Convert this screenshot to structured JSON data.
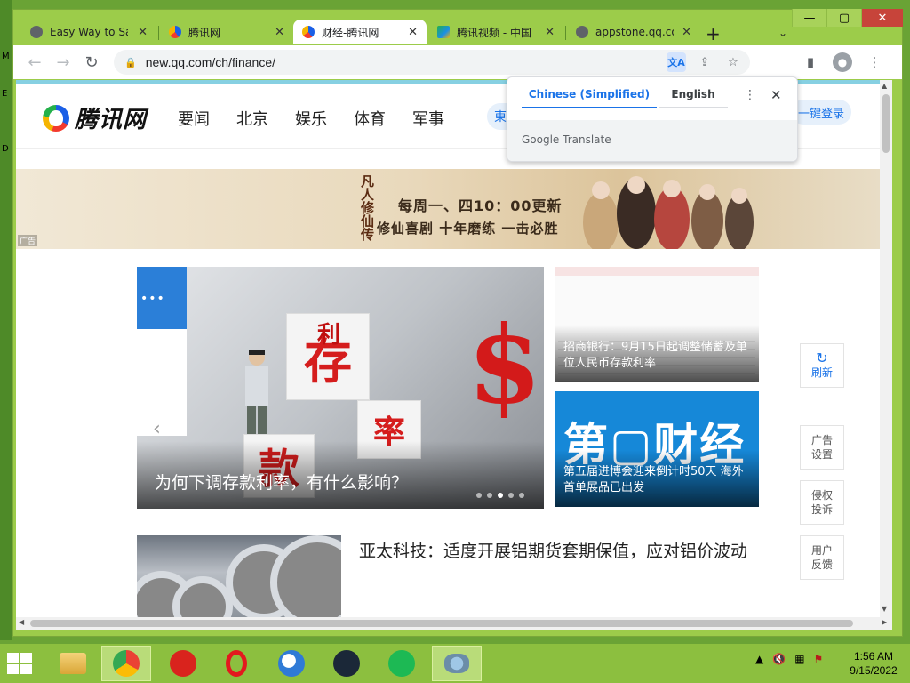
{
  "browser": {
    "tabs": [
      {
        "title": "Easy Way to Sav",
        "favicon": "globe-icon",
        "active": false
      },
      {
        "title": "腾讯网",
        "favicon": "tencent-icon",
        "active": false
      },
      {
        "title": "财经-腾讯网",
        "favicon": "tencent-icon",
        "active": true
      },
      {
        "title": "腾讯视频 - 中国",
        "favicon": "tencent-video-icon",
        "active": false
      },
      {
        "title": "appstone.qq.co",
        "favicon": "globe-icon",
        "active": false
      }
    ],
    "url": "new.qq.com/ch/finance/",
    "window_controls": [
      "minimize",
      "maximize",
      "close"
    ]
  },
  "translate_popup": {
    "source_lang": "Chinese (Simplified)",
    "target_lang": "English",
    "brand": "Google Translate"
  },
  "site": {
    "logo_text": "腾讯网",
    "nav": [
      "要闻",
      "北京",
      "娱乐",
      "体育",
      "军事"
    ],
    "search_partial": "東",
    "login": "一键登录"
  },
  "banner": {
    "line1": "每周一、四10：00更新",
    "line2": "修仙喜剧 十年磨练 一击必胜",
    "calligraphy": "凡人修仙传",
    "ad_tag": "广告"
  },
  "hero": {
    "caption": "为何下调存款利率，有什么影响？",
    "cube_chars": [
      "存",
      "款",
      "利",
      "率"
    ],
    "slides": 5,
    "active_slide": 3,
    "menu_dots": "•••"
  },
  "cards": [
    {
      "caption": "招商银行：9月15日起调整储蓄及单位人民币存款利率"
    },
    {
      "caption": "第五届进博会迎来倒计时50天 海外首单展品已出发",
      "big_text": "第▢财经"
    }
  ],
  "side_buttons": {
    "refresh": "刷新",
    "ad_settings": "广告\n设置",
    "rights": "侵权\n投诉",
    "feedback": "用户\n反馈"
  },
  "article": {
    "title": "亚太科技：适度开展铝期货套期保值，应对铝价波动"
  },
  "taskbar": {
    "apps": [
      "file-explorer-icon",
      "chrome-icon",
      "power-icon",
      "opera-icon",
      "thunderbird-icon",
      "steam-icon",
      "spotify-icon",
      "network-app-icon"
    ],
    "time": "1:56 AM",
    "date": "9/15/2022"
  },
  "colors": {
    "window_frame": "#9ccc4a",
    "taskbar": "#8cbf3f",
    "accent_blue": "#1a73e8",
    "close_red": "#c7443a"
  }
}
